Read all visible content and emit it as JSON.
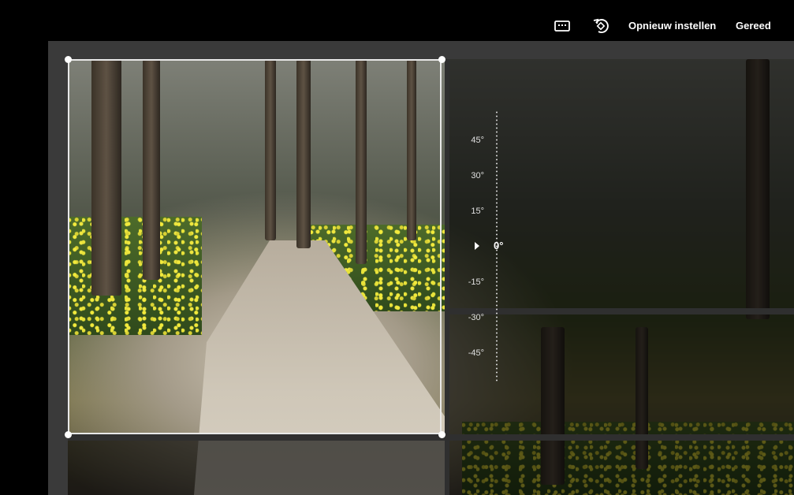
{
  "toolbar": {
    "aspect_icon": "aspect-ratio-icon",
    "rotate_icon": "rotate-icon",
    "reset_label": "Opnieuw instellen",
    "done_label": "Gereed"
  },
  "angle_dial": {
    "ticks": [
      "45°",
      "30°",
      "15°",
      "-15°",
      "-30°",
      "-45°"
    ],
    "current": "0°"
  },
  "colors": {
    "background": "#000000",
    "stage": "#3a3a3a",
    "crop_border": "#e8e8e8"
  }
}
